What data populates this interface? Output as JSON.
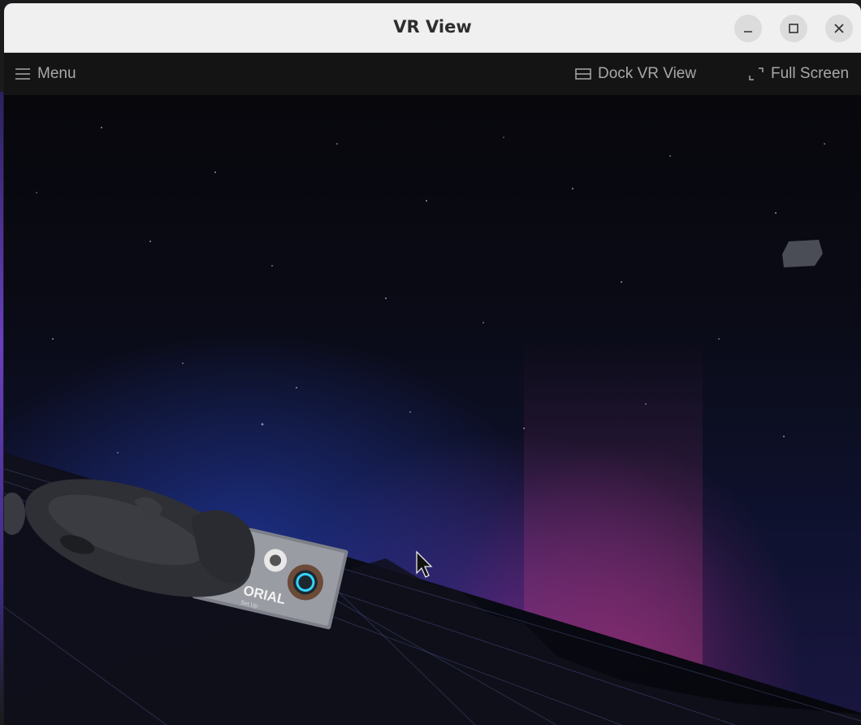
{
  "window": {
    "title": "VR View"
  },
  "titlebar_buttons": {
    "minimize": "minimize-icon",
    "maximize": "maximize-icon",
    "close": "close-icon"
  },
  "menubar": {
    "menu_label": "Menu",
    "dock_label": "Dock VR View",
    "fullscreen_label": "Full Screen"
  },
  "scene": {
    "tutorial_card_text": "ORIAL",
    "tutorial_card_subtext": "Set Up"
  }
}
